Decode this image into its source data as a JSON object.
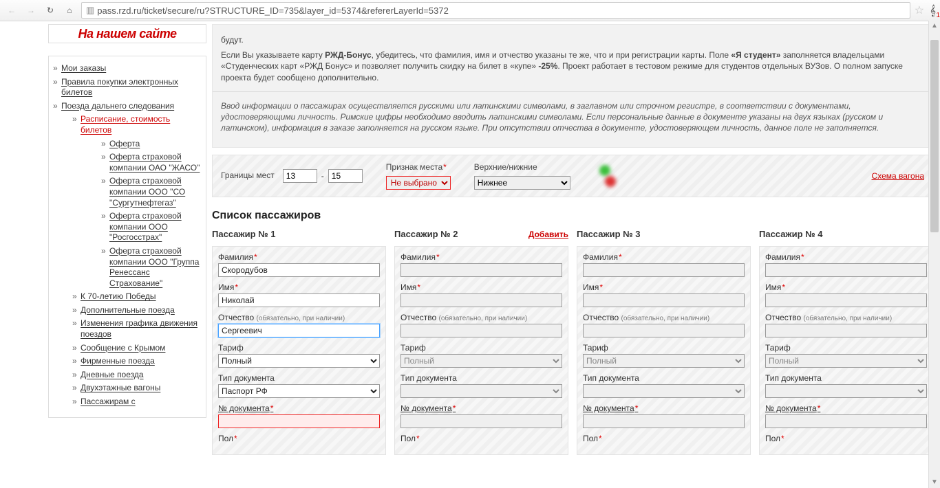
{
  "browser": {
    "url_display": "pass.rzd.ru/ticket/secure/ru?STRUCTURE_ID=735&layer_id=5374&refererLayerId=5372",
    "badge_count": "1"
  },
  "promo": "На нашем сайте",
  "sidebar": {
    "items": [
      {
        "label": "Мои заказы"
      },
      {
        "label": "Правила покупки электронных билетов"
      },
      {
        "label": "Поезда дальнего следования",
        "children": [
          {
            "label": "Расписание, стоимость билетов",
            "active": true,
            "children": [
              {
                "label": "Оферта"
              },
              {
                "label": "Оферта страховой компании ОАО \"ЖАСО\""
              },
              {
                "label": "Оферта страховой компании ООО \"СО \"Сургутнефтегаз\""
              },
              {
                "label": "Оферта страховой компании ООО \"Росгосстрах\""
              },
              {
                "label": "Оферта страховой компании ООО \"Группа Ренессанс Страхование\""
              }
            ]
          },
          {
            "label": "К 70-летию Победы"
          },
          {
            "label": "Дополнительные поезда"
          },
          {
            "label": "Изменения графика движения поездов"
          },
          {
            "label": "Сообщение с Крымом"
          },
          {
            "label": "Фирменные поезда"
          },
          {
            "label": "Дневные поезда"
          },
          {
            "label": "Двухэтажные вагоны"
          },
          {
            "label": "Пассажирам с"
          }
        ]
      }
    ]
  },
  "intro": {
    "line0": "будут.",
    "para1_pre": "Если Вы указываете карту ",
    "para1_b1": "РЖД-Бонус",
    "para1_mid": ", убедитесь, что фамилия, имя и отчество указаны те же, что и при регистрации карты. Поле ",
    "para1_b2": "«Я студент»",
    "para1_mid2": " заполняется владельцами «Студенческих карт «РЖД Бонус» и позволяет получить скидку на билет в «купе» ",
    "para1_b3": "-25%",
    "para1_end": ". Проект работает в тестовом режиме для студентов отдельных ВУЗов. О полном запуске проекта будет сообщено дополнительно.",
    "para2": "Ввод информации о пассажирах осуществляется русскими или латинскими символами, в заглавном или строчном регистре, в соответствии с документами, удостоверяющими личность. Римские цифры необходимо вводить латинскими символами. Если персональные данные в документе указаны на двух языках (русском и латинском), информация в заказе заполняется на русском языке. При отсутствии отчества в документе, удостоверяющем личность, данное поле не заполняется."
  },
  "seat_bar": {
    "range_label": "Границы мест",
    "from": "13",
    "to": "15",
    "sign_label": "Признак места",
    "sign_selected": "Не выбрано",
    "sign_options": [
      "Не выбрано"
    ],
    "tier_label": "Верхние/нижние",
    "tier_selected": "Нижнее",
    "tier_options": [
      "Нижнее"
    ],
    "scheme": "Схема вагона"
  },
  "passengers": {
    "heading": "Список пассажиров",
    "add": "Добавить",
    "labels": {
      "surname": "Фамилия",
      "name": "Имя",
      "patronymic": "Отчество",
      "patronymic_note": "(обязательно, при наличии)",
      "tariff": "Тариф",
      "doctype": "Тип документа",
      "docnum": "№ документа",
      "gender": "Пол"
    },
    "tariff_options": [
      "Полный"
    ],
    "doctype_options": [
      "Паспорт РФ"
    ],
    "columns": [
      {
        "title": "Пассажир № 1",
        "surname": "Скородубов",
        "name": "Николай",
        "patronymic": "Сергеевич",
        "tariff": "Полный",
        "doctype": "Паспорт РФ",
        "docnum": "",
        "active": true,
        "show_add": false,
        "focus": "patronymic",
        "error": "docnum"
      },
      {
        "title": "Пассажир № 2",
        "surname": "",
        "name": "",
        "patronymic": "",
        "tariff": "Полный",
        "doctype": "",
        "docnum": "",
        "active": false,
        "show_add": true
      },
      {
        "title": "Пассажир № 3",
        "surname": "",
        "name": "",
        "patronymic": "",
        "tariff": "Полный",
        "doctype": "",
        "docnum": "",
        "active": false,
        "show_add": false
      },
      {
        "title": "Пассажир № 4",
        "surname": "",
        "name": "",
        "patronymic": "",
        "tariff": "Полный",
        "doctype": "",
        "docnum": "",
        "active": false,
        "show_add": false
      }
    ]
  }
}
